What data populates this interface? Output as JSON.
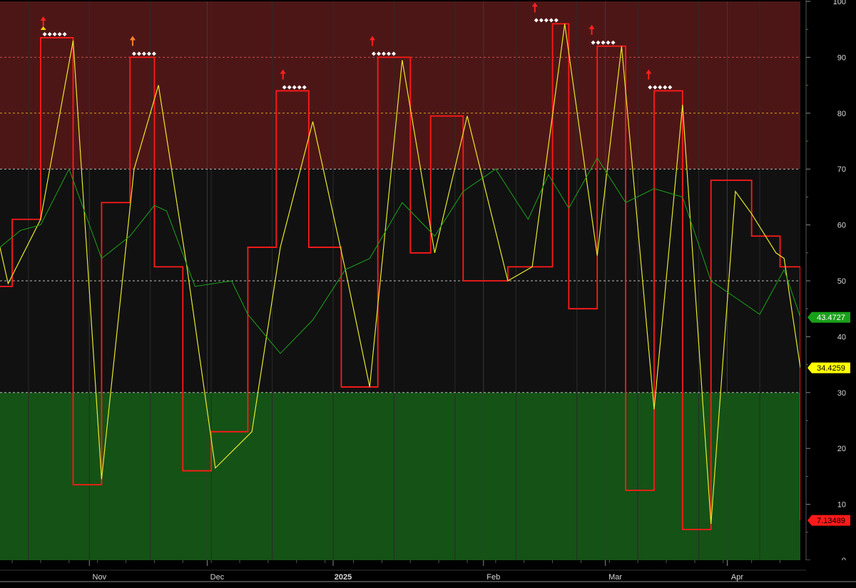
{
  "chart_data": {
    "type": "line",
    "title": "",
    "xlabel": "",
    "ylabel": "",
    "ylim": [
      0,
      100
    ],
    "yticks": [
      0,
      10,
      20,
      30,
      40,
      50,
      60,
      70,
      80,
      90,
      100
    ],
    "x_tick_labels": [
      {
        "label": "Nov",
        "x": 22
      },
      {
        "label": "Dec",
        "x": 51
      },
      {
        "label": "2025",
        "x": 82
      },
      {
        "label": "Feb",
        "x": 119
      },
      {
        "label": "Mar",
        "x": 149
      },
      {
        "label": "Apr",
        "x": 179
      }
    ],
    "x_range": [
      0,
      197
    ],
    "zones": [
      {
        "name": "overbought",
        "from": 70,
        "to": 100,
        "color": "#4d1616"
      },
      {
        "name": "neutral",
        "from": 30,
        "to": 70,
        "color": "#111111"
      },
      {
        "name": "oversold",
        "from": 0,
        "to": 30,
        "color": "#155216"
      }
    ],
    "reference_lines": [
      {
        "y": 90,
        "color": "#c0504d"
      },
      {
        "y": 80,
        "color": "#d4a017"
      },
      {
        "y": 70,
        "color": "#bbbbbb"
      },
      {
        "y": 50,
        "color": "#bbbbbb"
      },
      {
        "y": 30,
        "color": "#bbbbbb"
      }
    ],
    "grid": true,
    "vertical_grid_x": [
      22,
      51,
      82,
      119,
      149,
      179
    ],
    "series": [
      {
        "color": "#ff1a1a",
        "step": true,
        "width": 1.8,
        "x": [
          0,
          3,
          10,
          18,
          25,
          32,
          38,
          45,
          52,
          61,
          68,
          76,
          84,
          93,
          101,
          106,
          114,
          125,
          136,
          140,
          147,
          154,
          161,
          168,
          175,
          185,
          192,
          197
        ],
        "y": [
          49,
          61,
          93.5,
          13.5,
          64,
          90,
          52.5,
          16,
          23,
          56,
          84,
          56,
          31,
          90,
          55,
          79.5,
          50,
          52.5,
          96,
          45,
          92,
          12.5,
          84,
          5.5,
          68,
          58,
          52.5,
          7.13
        ]
      },
      {
        "color": "#e8e82a",
        "step": false,
        "width": 1.2,
        "x": [
          0,
          2,
          10,
          18,
          25,
          33,
          39,
          46,
          53,
          62,
          69,
          77,
          85,
          91,
          99,
          107,
          115,
          125,
          131,
          139,
          147,
          153,
          161,
          168,
          175,
          181,
          185,
          191,
          193,
          197
        ],
        "y": [
          56,
          49.5,
          61,
          93,
          14.5,
          70,
          85,
          52.5,
          16.5,
          23,
          56,
          78.5,
          52,
          31,
          89.5,
          55,
          79.5,
          50,
          52.5,
          96,
          54.5,
          92,
          27,
          81.5,
          6.5,
          66,
          62,
          55,
          54,
          34.43
        ]
      },
      {
        "color": "#1aa51a",
        "step": false,
        "width": 1.0,
        "x": [
          0,
          5,
          10,
          17,
          25,
          32,
          38,
          41,
          48,
          57,
          61,
          69,
          77,
          85,
          91,
          99,
          107,
          114,
          122,
          130,
          135,
          140,
          147,
          154,
          161,
          168,
          175,
          181,
          187,
          193,
          197
        ],
        "y": [
          56,
          59,
          60,
          70,
          54,
          58,
          63.5,
          62.5,
          49,
          50,
          44,
          37,
          43,
          52,
          54,
          64,
          58,
          66,
          70,
          61,
          69,
          63,
          72,
          64,
          66.5,
          65,
          50,
          47,
          44,
          52,
          43.47
        ]
      }
    ],
    "peak_markers": [
      {
        "x": 11,
        "y": 93.5,
        "arrow_color": "#ff2020",
        "extra_yellow": true
      },
      {
        "x": 33,
        "y": 90,
        "arrow_color": "#ff8030",
        "extra_yellow": false
      },
      {
        "x": 70,
        "y": 84,
        "arrow_color": "#ff2020",
        "extra_yellow": false
      },
      {
        "x": 92,
        "y": 90,
        "arrow_color": "#ff2020",
        "extra_yellow": false
      },
      {
        "x": 132,
        "y": 96,
        "arrow_color": "#ff2020",
        "extra_yellow": false
      },
      {
        "x": 146,
        "y": 92,
        "arrow_color": "#ff2020",
        "extra_yellow": false
      },
      {
        "x": 160,
        "y": 84,
        "arrow_color": "#ff2020",
        "extra_yellow": false
      }
    ],
    "price_labels": [
      {
        "text": "43.4727",
        "value": 43.47,
        "bg": "#19a019",
        "fg": "#ffffff"
      },
      {
        "text": "34.4259",
        "value": 34.43,
        "bg": "#ffff00",
        "fg": "#000000"
      },
      {
        "text": "7.13489",
        "value": 7.13,
        "bg": "#ff1a1a",
        "fg": "#000000"
      }
    ]
  }
}
